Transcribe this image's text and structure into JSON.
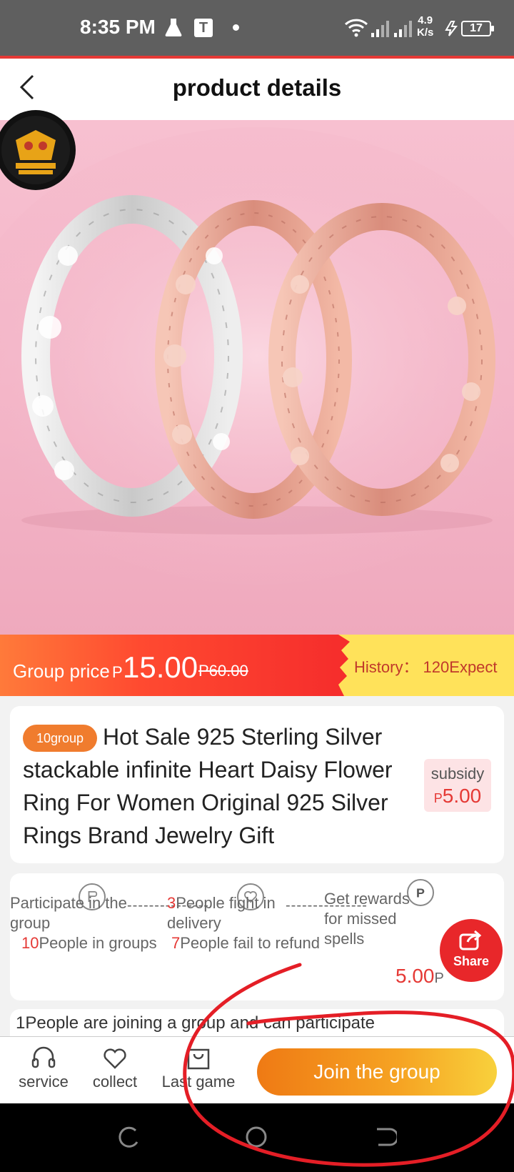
{
  "status_bar": {
    "time": "8:35 PM",
    "t_icon": "T",
    "speed_value": "4.9",
    "speed_unit": "K/s",
    "battery": "17"
  },
  "header": {
    "title": "product details",
    "back_icon": "chevron-left-icon"
  },
  "gallery": {
    "image_count": 4,
    "active_index": 1
  },
  "price": {
    "label": "Group price",
    "currency": "P",
    "value": "15.00",
    "original": "P60.00",
    "history": "History： 120Expect",
    "colors": {
      "band_red": "#f52c2c",
      "band_yellow": "#ffe25a"
    }
  },
  "product": {
    "group_tag": "10group",
    "title": "Hot Sale 925 Sterling Silver stackable infinite Heart Daisy Flower Ring For Women Original 925 Silver Rings Brand Jewelry Gift",
    "subsidy_label": "subsidy",
    "subsidy_currency": "P",
    "subsidy_value": "5.00"
  },
  "steps": {
    "step1": {
      "text": "Participate in the group",
      "count": "10",
      "count_suffix": "People in groups"
    },
    "step2": {
      "count": "3",
      "text": "People fight in delivery",
      "count2": "7",
      "count2_suffix": "People fail to refund"
    },
    "step3": {
      "text": "Get rewards for missed spells",
      "value": "5.00",
      "currency": "P"
    },
    "dashes": "---------------"
  },
  "share": {
    "label": "Share"
  },
  "joining_text": "1People are joining a group and can participate",
  "bottom_bar": {
    "service": "service",
    "collect": "collect",
    "last_game": "Last game",
    "join": "Join the group"
  }
}
